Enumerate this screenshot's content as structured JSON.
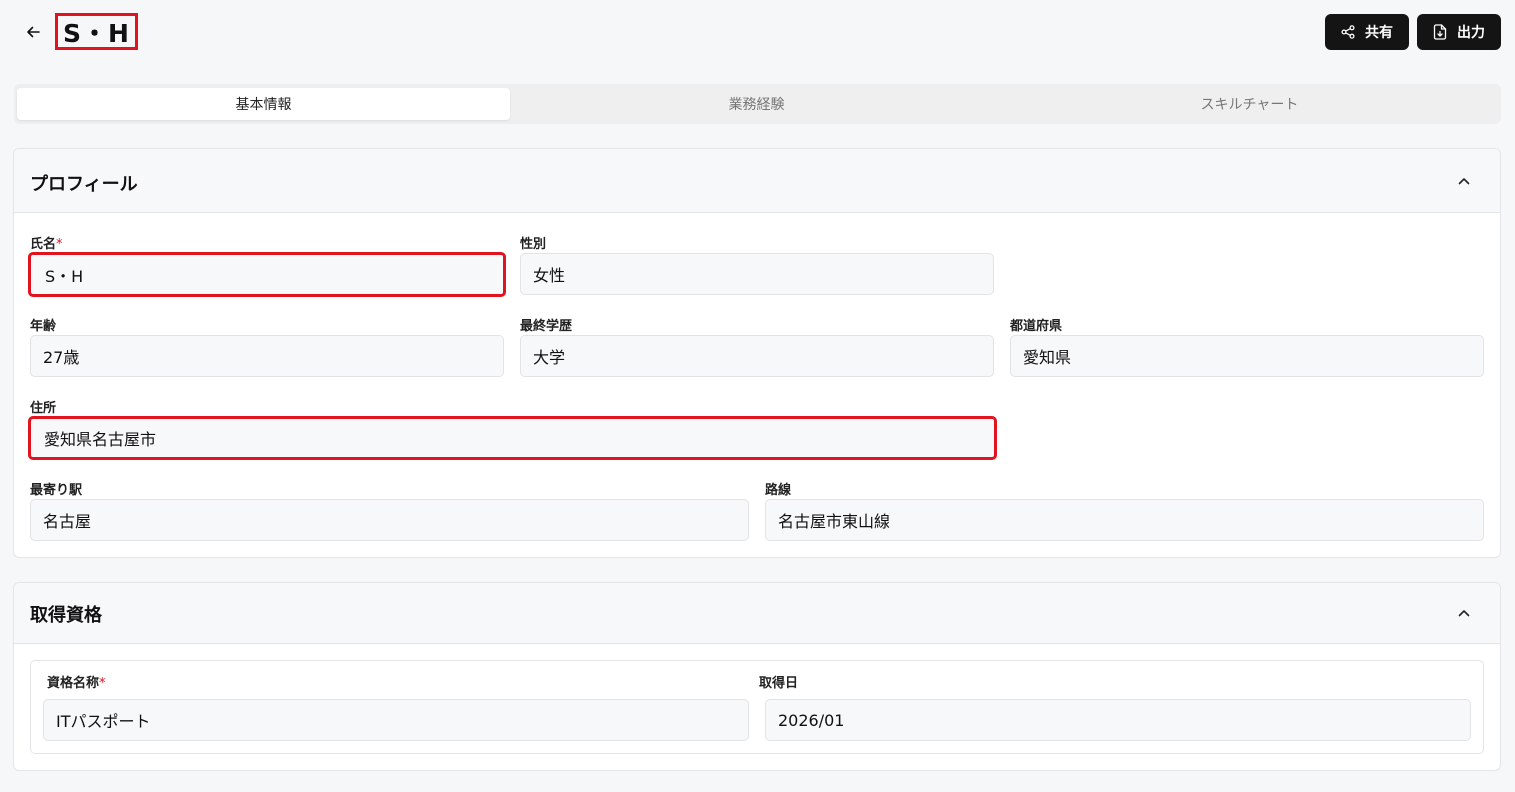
{
  "header": {
    "title": "S・H",
    "share_label": "共有",
    "export_label": "出力"
  },
  "tabs": [
    {
      "label": "基本情報",
      "active": true
    },
    {
      "label": "業務経験",
      "active": false
    },
    {
      "label": "スキルチャート",
      "active": false
    }
  ],
  "profile": {
    "title": "プロフィール",
    "name": {
      "label": "氏名",
      "required": "*",
      "value": "S・H"
    },
    "gender": {
      "label": "性別",
      "value": "女性"
    },
    "age": {
      "label": "年齢",
      "value": "27歳"
    },
    "education": {
      "label": "最終学歴",
      "value": "大学"
    },
    "prefecture": {
      "label": "都道府県",
      "value": "愛知県"
    },
    "address": {
      "label": "住所",
      "value": "愛知県名古屋市"
    },
    "station": {
      "label": "最寄り駅",
      "value": "名古屋"
    },
    "line": {
      "label": "路線",
      "value": "名古屋市東山線"
    }
  },
  "certifications": {
    "title": "取得資格",
    "name_label": "資格名称",
    "name_required": "*",
    "date_label": "取得日",
    "items": [
      {
        "name": "ITパスポート",
        "date": "2026/01"
      }
    ]
  },
  "colors": {
    "highlight": "#e0131e",
    "button_bg": "#141414"
  }
}
